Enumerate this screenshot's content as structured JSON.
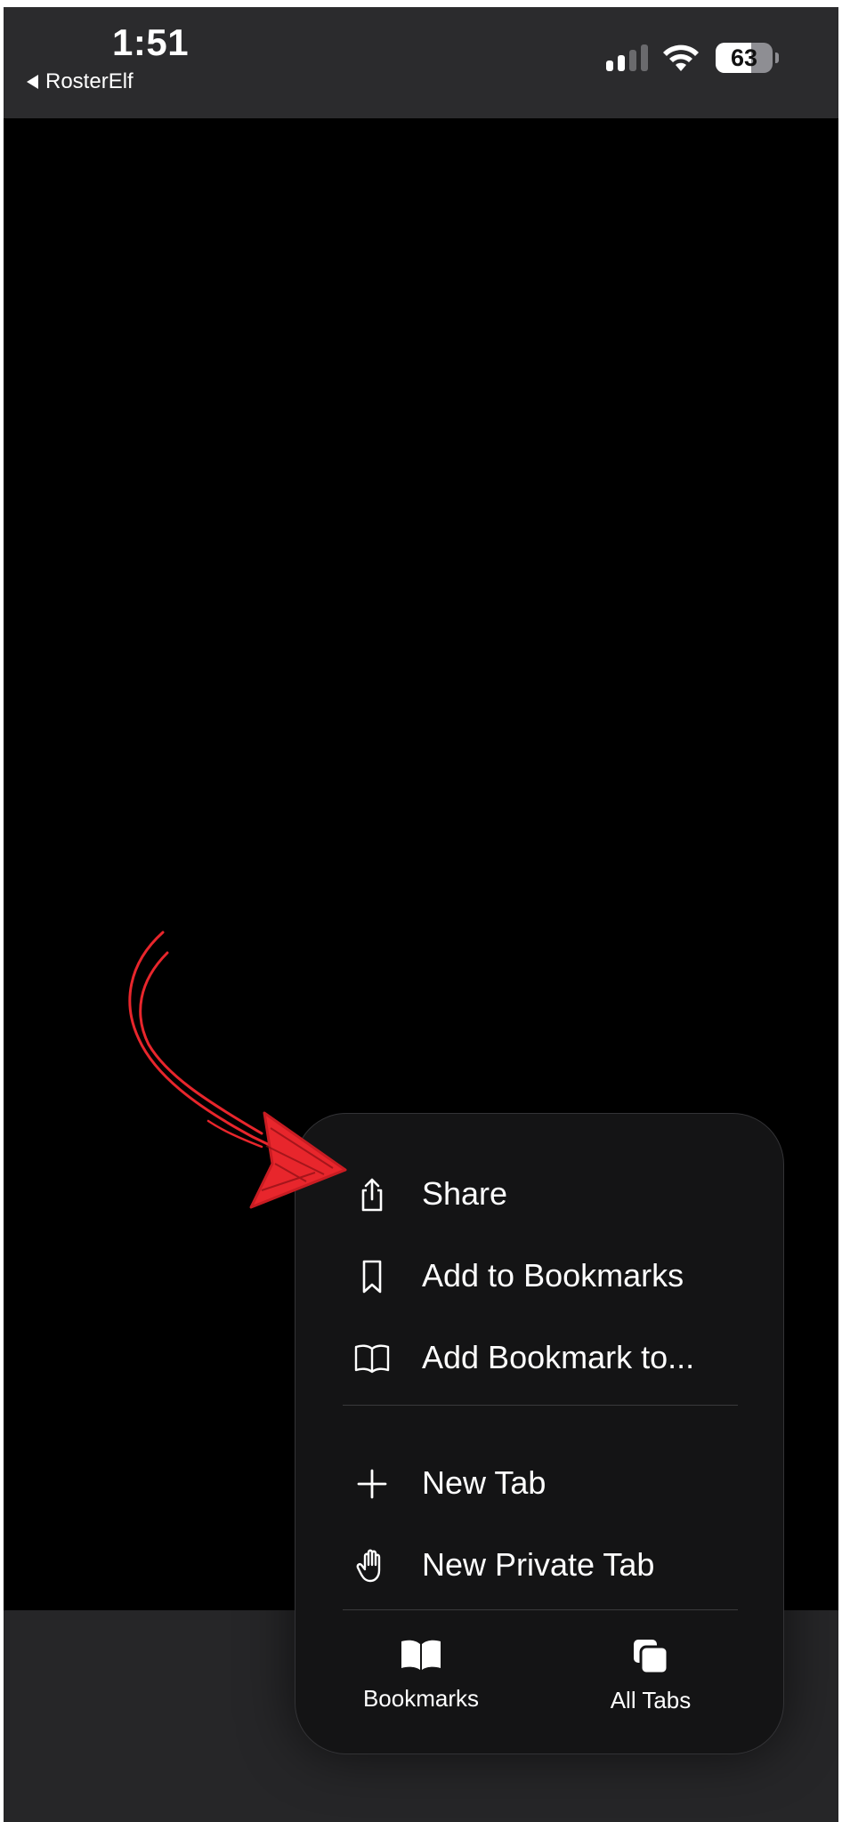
{
  "status_bar": {
    "time": "1:51",
    "back_app": "RosterElf",
    "battery_level": 63,
    "signal_bars_active": 2,
    "signal_bars_total": 4
  },
  "menu": {
    "items": [
      {
        "label": "Share",
        "icon": "share-icon"
      },
      {
        "label": "Add to Bookmarks",
        "icon": "bookmark-icon"
      },
      {
        "label": "Add Bookmark to...",
        "icon": "book-open-icon"
      },
      {
        "label": "New Tab",
        "icon": "plus-icon"
      },
      {
        "label": "New Private Tab",
        "icon": "hand-icon"
      }
    ],
    "bottom_buttons": [
      {
        "label": "Bookmarks",
        "icon": "bookmarks-book-icon"
      },
      {
        "label": "All Tabs",
        "icon": "tabs-icon"
      }
    ]
  },
  "colors": {
    "annotation": "#e8262c",
    "status_bar_bg": "#2b2b2d",
    "menu_bg": "#141415"
  }
}
